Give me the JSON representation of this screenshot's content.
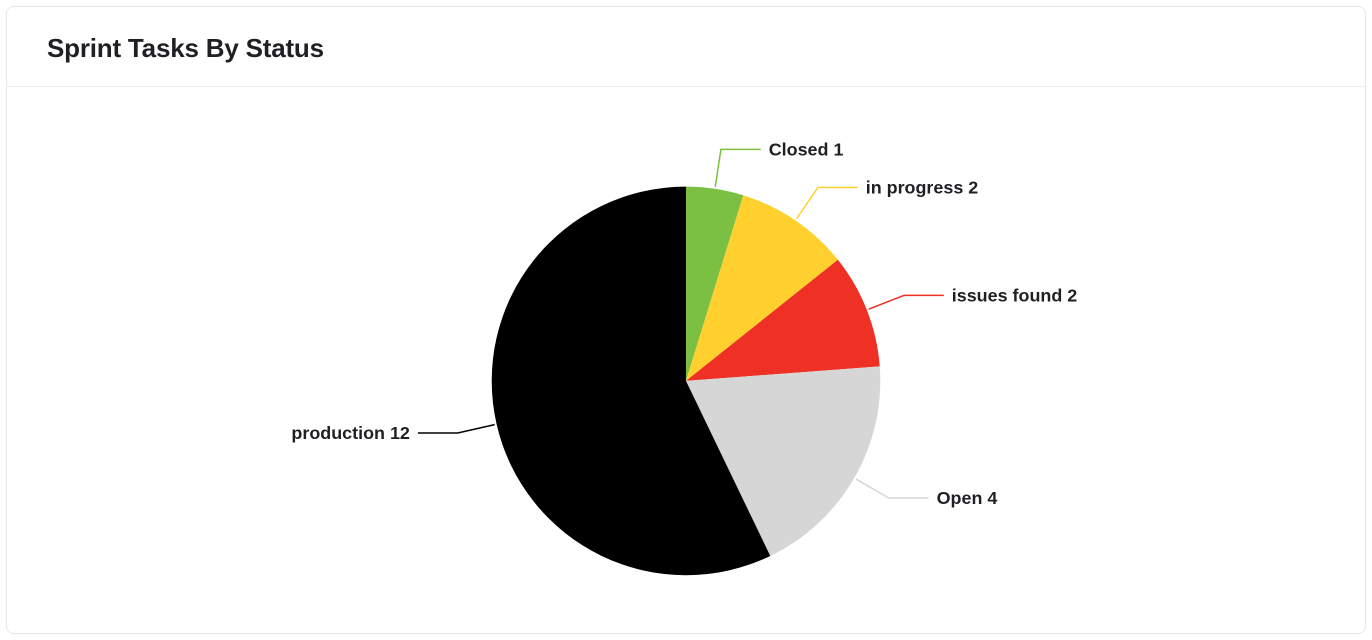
{
  "card": {
    "title": "Sprint Tasks By Status"
  },
  "chart_data": {
    "type": "pie",
    "title": "Sprint Tasks By Status",
    "series": [
      {
        "name": "Closed",
        "value": 1,
        "color": "#7bc043"
      },
      {
        "name": "in progress",
        "value": 2,
        "color": "#ffd02e"
      },
      {
        "name": "issues found",
        "value": 2,
        "color": "#ee3124"
      },
      {
        "name": "Open",
        "value": 4,
        "color": "#d6d6d6"
      },
      {
        "name": "production",
        "value": 12,
        "color": "#000000"
      }
    ]
  }
}
